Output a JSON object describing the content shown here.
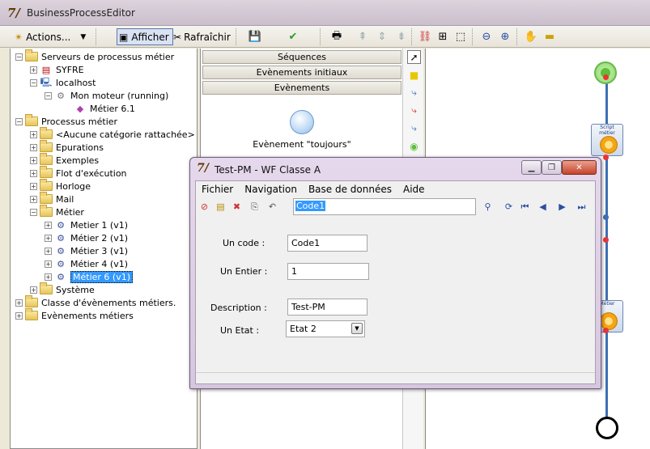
{
  "app": {
    "title": "BusinessProcessEditor"
  },
  "toolbar": {
    "actions_label": "Actions...",
    "afficher_label": "Afficher",
    "rafraichir_label": "Rafraîchir"
  },
  "tree": {
    "items": [
      {
        "label": "Serveurs de processus métier",
        "icon": "folder-icon"
      },
      {
        "label": "SYFRE",
        "icon": "server-icon"
      },
      {
        "label": "localhost",
        "icon": "computer-icon"
      },
      {
        "label": "Mon moteur (running)",
        "icon": "engine-icon"
      },
      {
        "label": "Métier 6.1",
        "icon": "diamond-icon"
      },
      {
        "label": "Processus métier",
        "icon": "folder-icon"
      },
      {
        "label": "<Aucune catégorie rattachée>",
        "icon": "folder-icon"
      },
      {
        "label": "Epurations",
        "icon": "folder-icon"
      },
      {
        "label": "Exemples",
        "icon": "folder-icon"
      },
      {
        "label": "Flot d'exécution",
        "icon": "folder-icon"
      },
      {
        "label": "Horloge",
        "icon": "folder-icon"
      },
      {
        "label": "Mail",
        "icon": "folder-icon"
      },
      {
        "label": "Métier",
        "icon": "folder-icon"
      },
      {
        "label": "Metier 1 (v1)",
        "icon": "process-icon"
      },
      {
        "label": "Métier 2 (v1)",
        "icon": "process-icon"
      },
      {
        "label": "Métier 3 (v1)",
        "icon": "process-icon"
      },
      {
        "label": "Métier 4 (v1)",
        "icon": "process-icon"
      },
      {
        "label": "Métier 6 (v1)",
        "icon": "process-icon"
      },
      {
        "label": "Système",
        "icon": "folder-icon"
      },
      {
        "label": "Classe d'évènements métiers.",
        "icon": "folder-icon"
      },
      {
        "label": "Evènements métiers",
        "icon": "folder-icon"
      }
    ]
  },
  "palette_panel": {
    "sections": [
      "Séquences",
      "Evènements initiaux",
      "Evènements"
    ],
    "event_label": "Evènement \"toujours\""
  },
  "canvas": {
    "task_label": "Script métier",
    "task_label_2": "Métier"
  },
  "dialog": {
    "title": "Test-PM -  WF Classe A",
    "menu": [
      "Fichier",
      "Navigation",
      "Base de données",
      "Aide"
    ],
    "search_value": "Code1",
    "fields": {
      "code_label": "Un code :",
      "code_value": "Code1",
      "entier_label": "Un Entier :",
      "entier_value": "1",
      "description_label": "Description :",
      "description_value": "Test-PM",
      "etat_label": "Un Etat :",
      "etat_value": "Etat 2"
    }
  },
  "colors": {
    "selection": "#3399ff",
    "flow": "#3d6fb5",
    "start_node": "#65b94b"
  }
}
